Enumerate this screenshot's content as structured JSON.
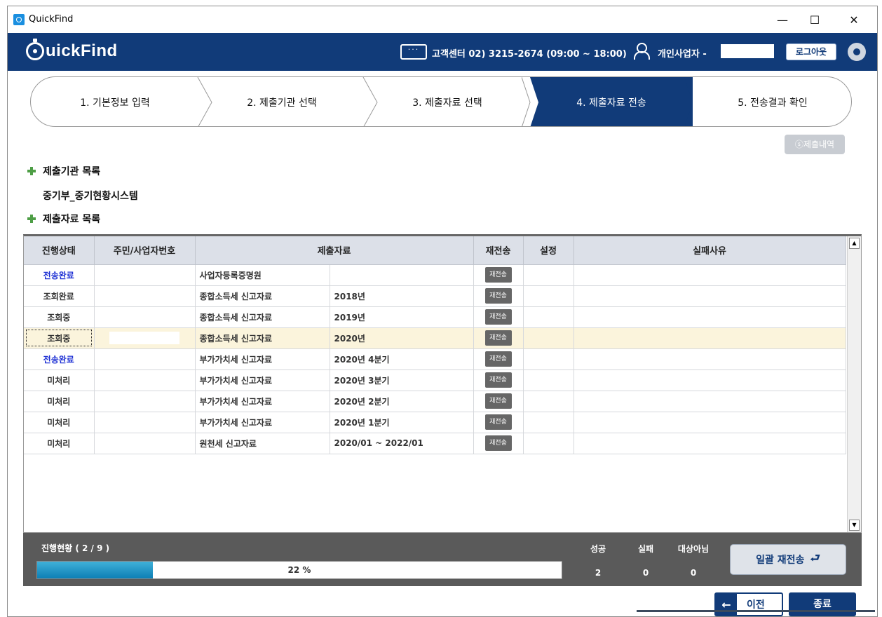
{
  "window": {
    "title": "QuickFind",
    "minimize": "—",
    "maximize": "☐",
    "close": "✕"
  },
  "header": {
    "logo_text": "uickFind",
    "chat_icon_glyph": "···",
    "customer_center": "고객센터 02) 3215-2674 (09:00 ~ 18:00)",
    "user_label": "개인사업자 -",
    "logout": "로그아웃"
  },
  "steps": [
    {
      "label": "1. 기본정보 입력",
      "active": false
    },
    {
      "label": "2. 제출기관 선택",
      "active": false
    },
    {
      "label": "3. 제출자료 선택",
      "active": false
    },
    {
      "label": "4. 제출자료 전송",
      "active": true
    },
    {
      "label": "5. 전송결과 확인",
      "active": false
    }
  ],
  "history_button": "ⓢ제출내역",
  "agency_section_title": "제출기관 목록",
  "agency_name": "중기부_중기현황시스템",
  "data_section_title": "제출자료 목록",
  "table": {
    "headers": [
      "진행상태",
      "주민/사업자번호",
      "제출자료",
      "재전송",
      "설정",
      "실패사유"
    ],
    "resend_label": "재전송",
    "rows": [
      {
        "status": "전송완료",
        "id": "",
        "doc": "사업자등록증명원",
        "period": "",
        "done": true,
        "selected": false
      },
      {
        "status": "조회완료",
        "id": "",
        "doc": "종합소득세 신고자료",
        "period": "2018년",
        "done": false,
        "selected": false
      },
      {
        "status": "조회중",
        "id": "",
        "doc": "종합소득세 신고자료",
        "period": "2019년",
        "done": false,
        "selected": false
      },
      {
        "status": "조회중",
        "id": "",
        "doc": "종합소득세 신고자료",
        "period": "2020년",
        "done": false,
        "selected": true
      },
      {
        "status": "전송완료",
        "id": "",
        "doc": "부가가치세 신고자료",
        "period": "2020년 4분기",
        "done": true,
        "selected": false
      },
      {
        "status": "미처리",
        "id": "",
        "doc": "부가가치세 신고자료",
        "period": "2020년 3분기",
        "done": false,
        "selected": false
      },
      {
        "status": "미처리",
        "id": "",
        "doc": "부가가치세 신고자료",
        "period": "2020년 2분기",
        "done": false,
        "selected": false
      },
      {
        "status": "미처리",
        "id": "",
        "doc": "부가가치세 신고자료",
        "period": "2020년 1분기",
        "done": false,
        "selected": false
      },
      {
        "status": "미처리",
        "id": "",
        "doc": "원천세 신고자료",
        "period": "2020/01 ~ 2022/01",
        "done": false,
        "selected": false
      }
    ]
  },
  "progress": {
    "label": "진행현황 ( 2 / 9 )",
    "fraction": 0.22,
    "percent_text": "22 %",
    "stats": [
      {
        "label": "성공",
        "value": "2"
      },
      {
        "label": "실패",
        "value": "0"
      },
      {
        "label": "대상아님",
        "value": "0"
      }
    ],
    "bulk_resend": "일괄 재전송"
  },
  "buttons": {
    "prev": "이전",
    "end": "종료"
  },
  "colors": {
    "brand": "#113b79",
    "done_status": "#1c2fd4",
    "selected_row": "#fbf4dc",
    "progress_fill": "#0d7fb5"
  }
}
